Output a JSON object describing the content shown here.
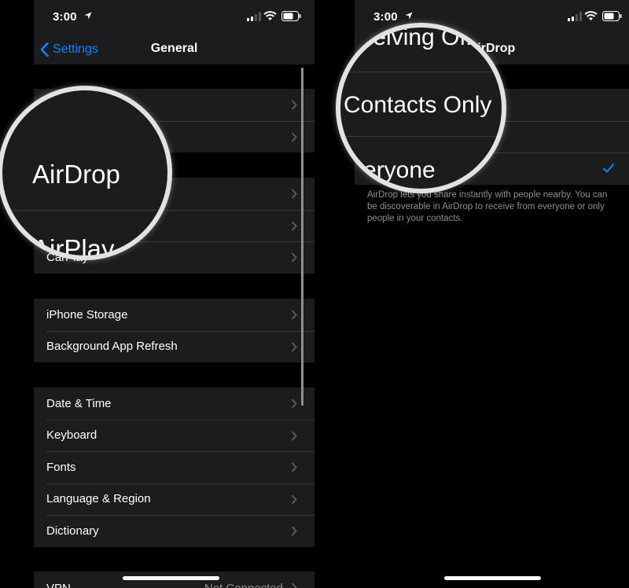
{
  "status_bar": {
    "time": "3:00"
  },
  "left_screen": {
    "back_label": "Settings",
    "title": "General",
    "magnifier_text": "AirDrop",
    "magnifier_text_cut": "AirPlay",
    "section2": [
      "",
      "",
      "CarPlay"
    ],
    "section3": [
      "iPhone Storage",
      "Background App Refresh"
    ],
    "section4": [
      "Date & Time",
      "Keyboard",
      "Fonts",
      "Language & Region",
      "Dictionary"
    ],
    "vpn_label": "VPN",
    "vpn_status": "Not Connected"
  },
  "right_screen": {
    "title": "AirDrop",
    "magnifier_top": "Receiving Off",
    "magnifier_main": "Contacts Only",
    "magnifier_bottom": "Everyone",
    "footer": "AirDrop lets you share instantly with people nearby. You can be discoverable in AirDrop to receive from everyone or only people in your contacts."
  },
  "colors": {
    "accent": "#0a84ff",
    "cell_bg": "#1c1c1e",
    "page_bg": "#000000",
    "secondary_text": "#8e8e93"
  }
}
